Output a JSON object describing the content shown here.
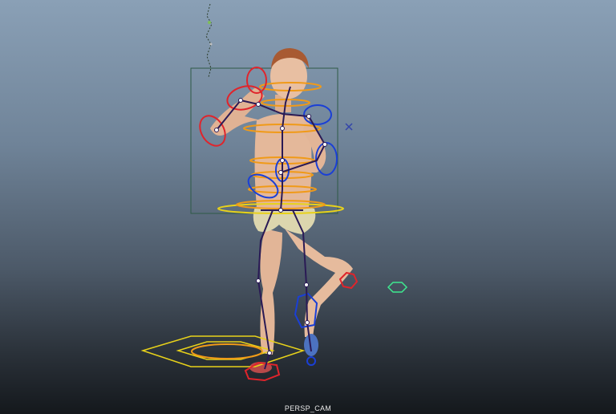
{
  "viewport": {
    "camera_label": "PERSP_CAM"
  },
  "colors": {
    "ik_left": "#e0242b",
    "ik_right": "#1a3fd6",
    "spine_controls": "#f09a18",
    "root_control": "#e8d21a",
    "bone": "#2a1a55",
    "selection_box": "#2e5a46",
    "locator_green": "#3ee88f",
    "locator_blue": "#3344aa",
    "skin": "#e4b89a",
    "shorts": "#dcd6ae",
    "hair": "#a85a32"
  },
  "icons": {
    "pole_vector": "x-marker-icon",
    "light": "directional-light-icon"
  }
}
